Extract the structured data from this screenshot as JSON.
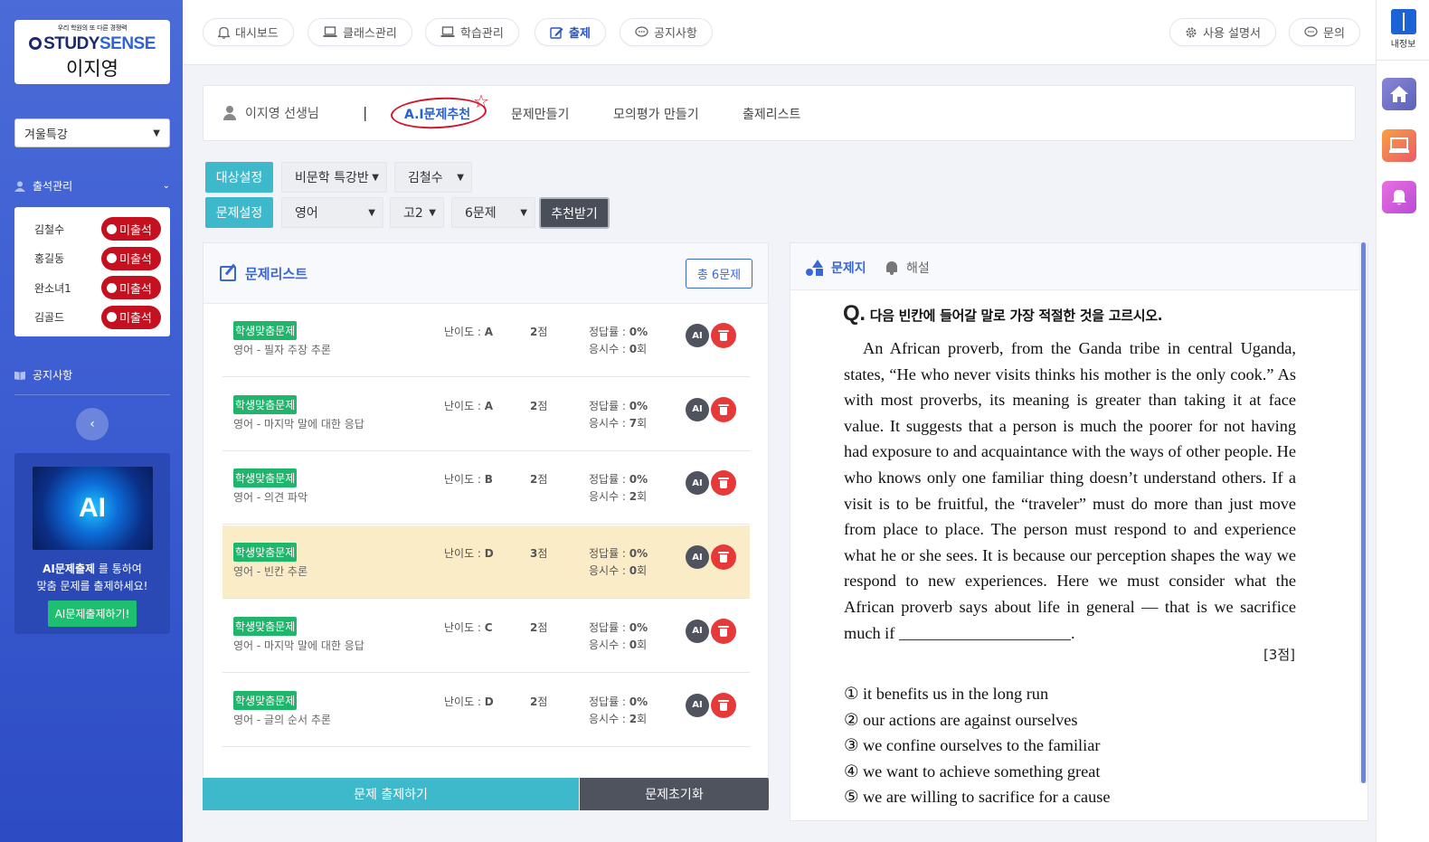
{
  "sidebar": {
    "logo_tagline": "우리 학원의 또 다른 경쟁력",
    "logo_study": "STUDY",
    "logo_sense": "SENSE",
    "user_name": "이지영",
    "season_select": "겨울특강",
    "attendance_title": "출석관리",
    "attendance": [
      {
        "name": "김철수",
        "status": "미출석"
      },
      {
        "name": "홍길동",
        "status": "미출석"
      },
      {
        "name": "완소녀1",
        "status": "미출석"
      },
      {
        "name": "김골드",
        "status": "미출석"
      }
    ],
    "notice_title": "공지사항",
    "collapse_symbol": "‹",
    "ai_promo": {
      "image_text": "AI",
      "line1_bold": "AI문제출제",
      "line1_rest": " 를 통하여",
      "line2": "맞춤 문제를 출제하세요!",
      "button": "AI문제출제하기!"
    }
  },
  "topnav": {
    "items": [
      {
        "label": "대시보드",
        "icon": "bell-icon"
      },
      {
        "label": "클래스관리",
        "icon": "laptop-icon"
      },
      {
        "label": "학습관리",
        "icon": "laptop-icon"
      },
      {
        "label": "출제",
        "icon": "edit-icon",
        "active": true
      },
      {
        "label": "공지사항",
        "icon": "chat-icon"
      }
    ],
    "manual": "사용 설명서",
    "inquiry": "문의"
  },
  "rail": {
    "my_info": "내정보",
    "colors": {
      "home": "#6e72c6",
      "screen": "#f07a4a",
      "bell": "#d45ad8"
    }
  },
  "tabs": {
    "teacher": "이지영 선생님",
    "divider": "|",
    "items": [
      "A.I문제추천",
      "문제만들기",
      "모의평가 만들기",
      "출제리스트"
    ],
    "active_index": 0
  },
  "filters": {
    "target_label": "대상설정",
    "class_select": "비문학 특강반",
    "student_select": "김철수",
    "problem_label": "문제설정",
    "subject_select": "영어",
    "grade_select": "고2",
    "count_select": "6문제",
    "recommend_button": "추천받기"
  },
  "problem_list": {
    "title": "문제리스트",
    "total": "총 6문제",
    "difficulty_label": "난이도 : ",
    "rate_label": "정답률 : ",
    "attempts_label": "응시수 : ",
    "ai_label": "AI",
    "rows": [
      {
        "tag": "학생맞춤문제",
        "subject": "영어 - 필자 주장 추론",
        "difficulty": "A",
        "points": "2",
        "points_unit": "점",
        "rate": "0%",
        "attempts": "0",
        "attempts_unit": "회"
      },
      {
        "tag": "학생맞춤문제",
        "subject": "영어 - 마지막 말에 대한 응답",
        "difficulty": "A",
        "points": "2",
        "points_unit": "점",
        "rate": "0%",
        "attempts": "7",
        "attempts_unit": "회"
      },
      {
        "tag": "학생맞춤문제",
        "subject": "영어 - 의견 파악",
        "difficulty": "B",
        "points": "2",
        "points_unit": "점",
        "rate": "0%",
        "attempts": "2",
        "attempts_unit": "회"
      },
      {
        "tag": "학생맞춤문제",
        "subject": "영어 - 빈칸 추론",
        "difficulty": "D",
        "points": "3",
        "points_unit": "점",
        "rate": "0%",
        "attempts": "0",
        "attempts_unit": "회",
        "highlight": true
      },
      {
        "tag": "학생맞춤문제",
        "subject": "영어 - 마지막 말에 대한 응답",
        "difficulty": "C",
        "points": "2",
        "points_unit": "점",
        "rate": "0%",
        "attempts": "0",
        "attempts_unit": "회"
      },
      {
        "tag": "학생맞춤문제",
        "subject": "영어 - 글의 순서 추론",
        "difficulty": "D",
        "points": "2",
        "points_unit": "점",
        "rate": "0%",
        "attempts": "2",
        "attempts_unit": "회"
      }
    ],
    "submit_button": "문제 출제하기",
    "reset_button": "문제초기화"
  },
  "question": {
    "tab_sheet": "문제지",
    "tab_solution": "해설",
    "q_mark": "Q.",
    "title": "다음 빈칸에 들어갈 말로 가장 적절한 것을 고르시오.",
    "passage": "An African proverb, from the Ganda tribe in central Uganda, states, “He who never visits thinks his mother is the only cook.” As with most proverbs, its meaning is greater than taking it at face value. It suggests that a person is much the poorer for not having had exposure to and acquaintance with the ways of other people. He who knows only one familiar thing doesn’t understand others. If a visit is to be fruitful, the “traveler” must do more than just move from place to place. The person must respond to and experience what he or she sees. It is because our perception shapes the way we respond to new experiences. Here we must consider what the African proverb says about life in general — that is we sacrifice much if",
    "passage_end": ".",
    "points": "[3점]",
    "options": [
      "① it benefits us in the long run",
      "② our actions are against ourselves",
      "③ we confine ourselves to the familiar",
      "④ we want to achieve something great",
      "⑤ we are willing to sacrifice for a cause"
    ]
  }
}
